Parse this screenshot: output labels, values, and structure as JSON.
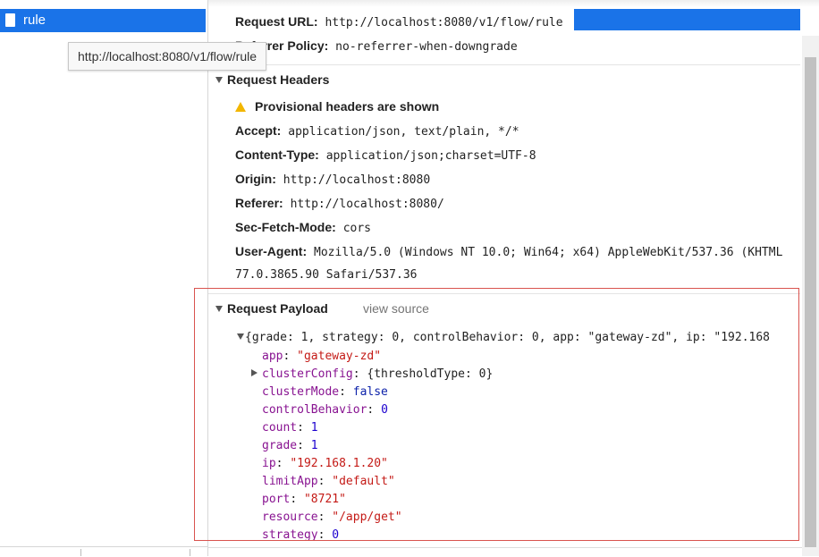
{
  "request_list": {
    "selected_request": "rule",
    "url_tooltip": "http://localhost:8080/v1/flow/rule"
  },
  "general": {
    "request_url_label": "Request URL:",
    "request_url_value": "http://localhost:8080/v1/flow/rule",
    "referrer_policy_label": "Referrer Policy:",
    "referrer_policy_value": "no-referrer-when-downgrade"
  },
  "request_headers": {
    "title": "Request Headers",
    "provisional_warning": "Provisional headers are shown",
    "headers": [
      {
        "name": "Accept:",
        "value": "application/json, text/plain, */*"
      },
      {
        "name": "Content-Type:",
        "value": "application/json;charset=UTF-8"
      },
      {
        "name": "Origin:",
        "value": "http://localhost:8080"
      },
      {
        "name": "Referer:",
        "value": "http://localhost:8080/"
      },
      {
        "name": "Sec-Fetch-Mode:",
        "value": "cors"
      },
      {
        "name": "User-Agent:",
        "value": "Mozilla/5.0 (Windows NT 10.0; Win64; x64) AppleWebKit/537.36 (KHTML"
      }
    ],
    "user_agent_continuation": "77.0.3865.90 Safari/537.36"
  },
  "request_payload": {
    "title": "Request Payload",
    "view_source": "view source",
    "summary": "{grade: 1, strategy: 0, controlBehavior: 0, app: \"gateway-zd\", ip: \"192.168",
    "fields": [
      {
        "key": "app",
        "value": "\"gateway-zd\"",
        "type": "str"
      },
      {
        "key": "clusterConfig",
        "value": "{thresholdType: 0}",
        "type": "plain",
        "expandable": true
      },
      {
        "key": "clusterMode",
        "value": "false",
        "type": "kw"
      },
      {
        "key": "controlBehavior",
        "value": "0",
        "type": "num"
      },
      {
        "key": "count",
        "value": "1",
        "type": "num"
      },
      {
        "key": "grade",
        "value": "1",
        "type": "num"
      },
      {
        "key": "ip",
        "value": "\"192.168.1.20\"",
        "type": "str"
      },
      {
        "key": "limitApp",
        "value": "\"default\"",
        "type": "str"
      },
      {
        "key": "port",
        "value": "\"8721\"",
        "type": "str"
      },
      {
        "key": "resource",
        "value": "\"/app/get\"",
        "type": "str"
      },
      {
        "key": "strategy",
        "value": "0",
        "type": "num"
      }
    ]
  },
  "colors": {
    "selection_blue": "#1a73e8",
    "annotation_red": "#d9534f",
    "key_purple": "#881391",
    "string_red": "#c41a16",
    "number_blue": "#1c00cf",
    "warning_yellow": "#f2b600"
  }
}
